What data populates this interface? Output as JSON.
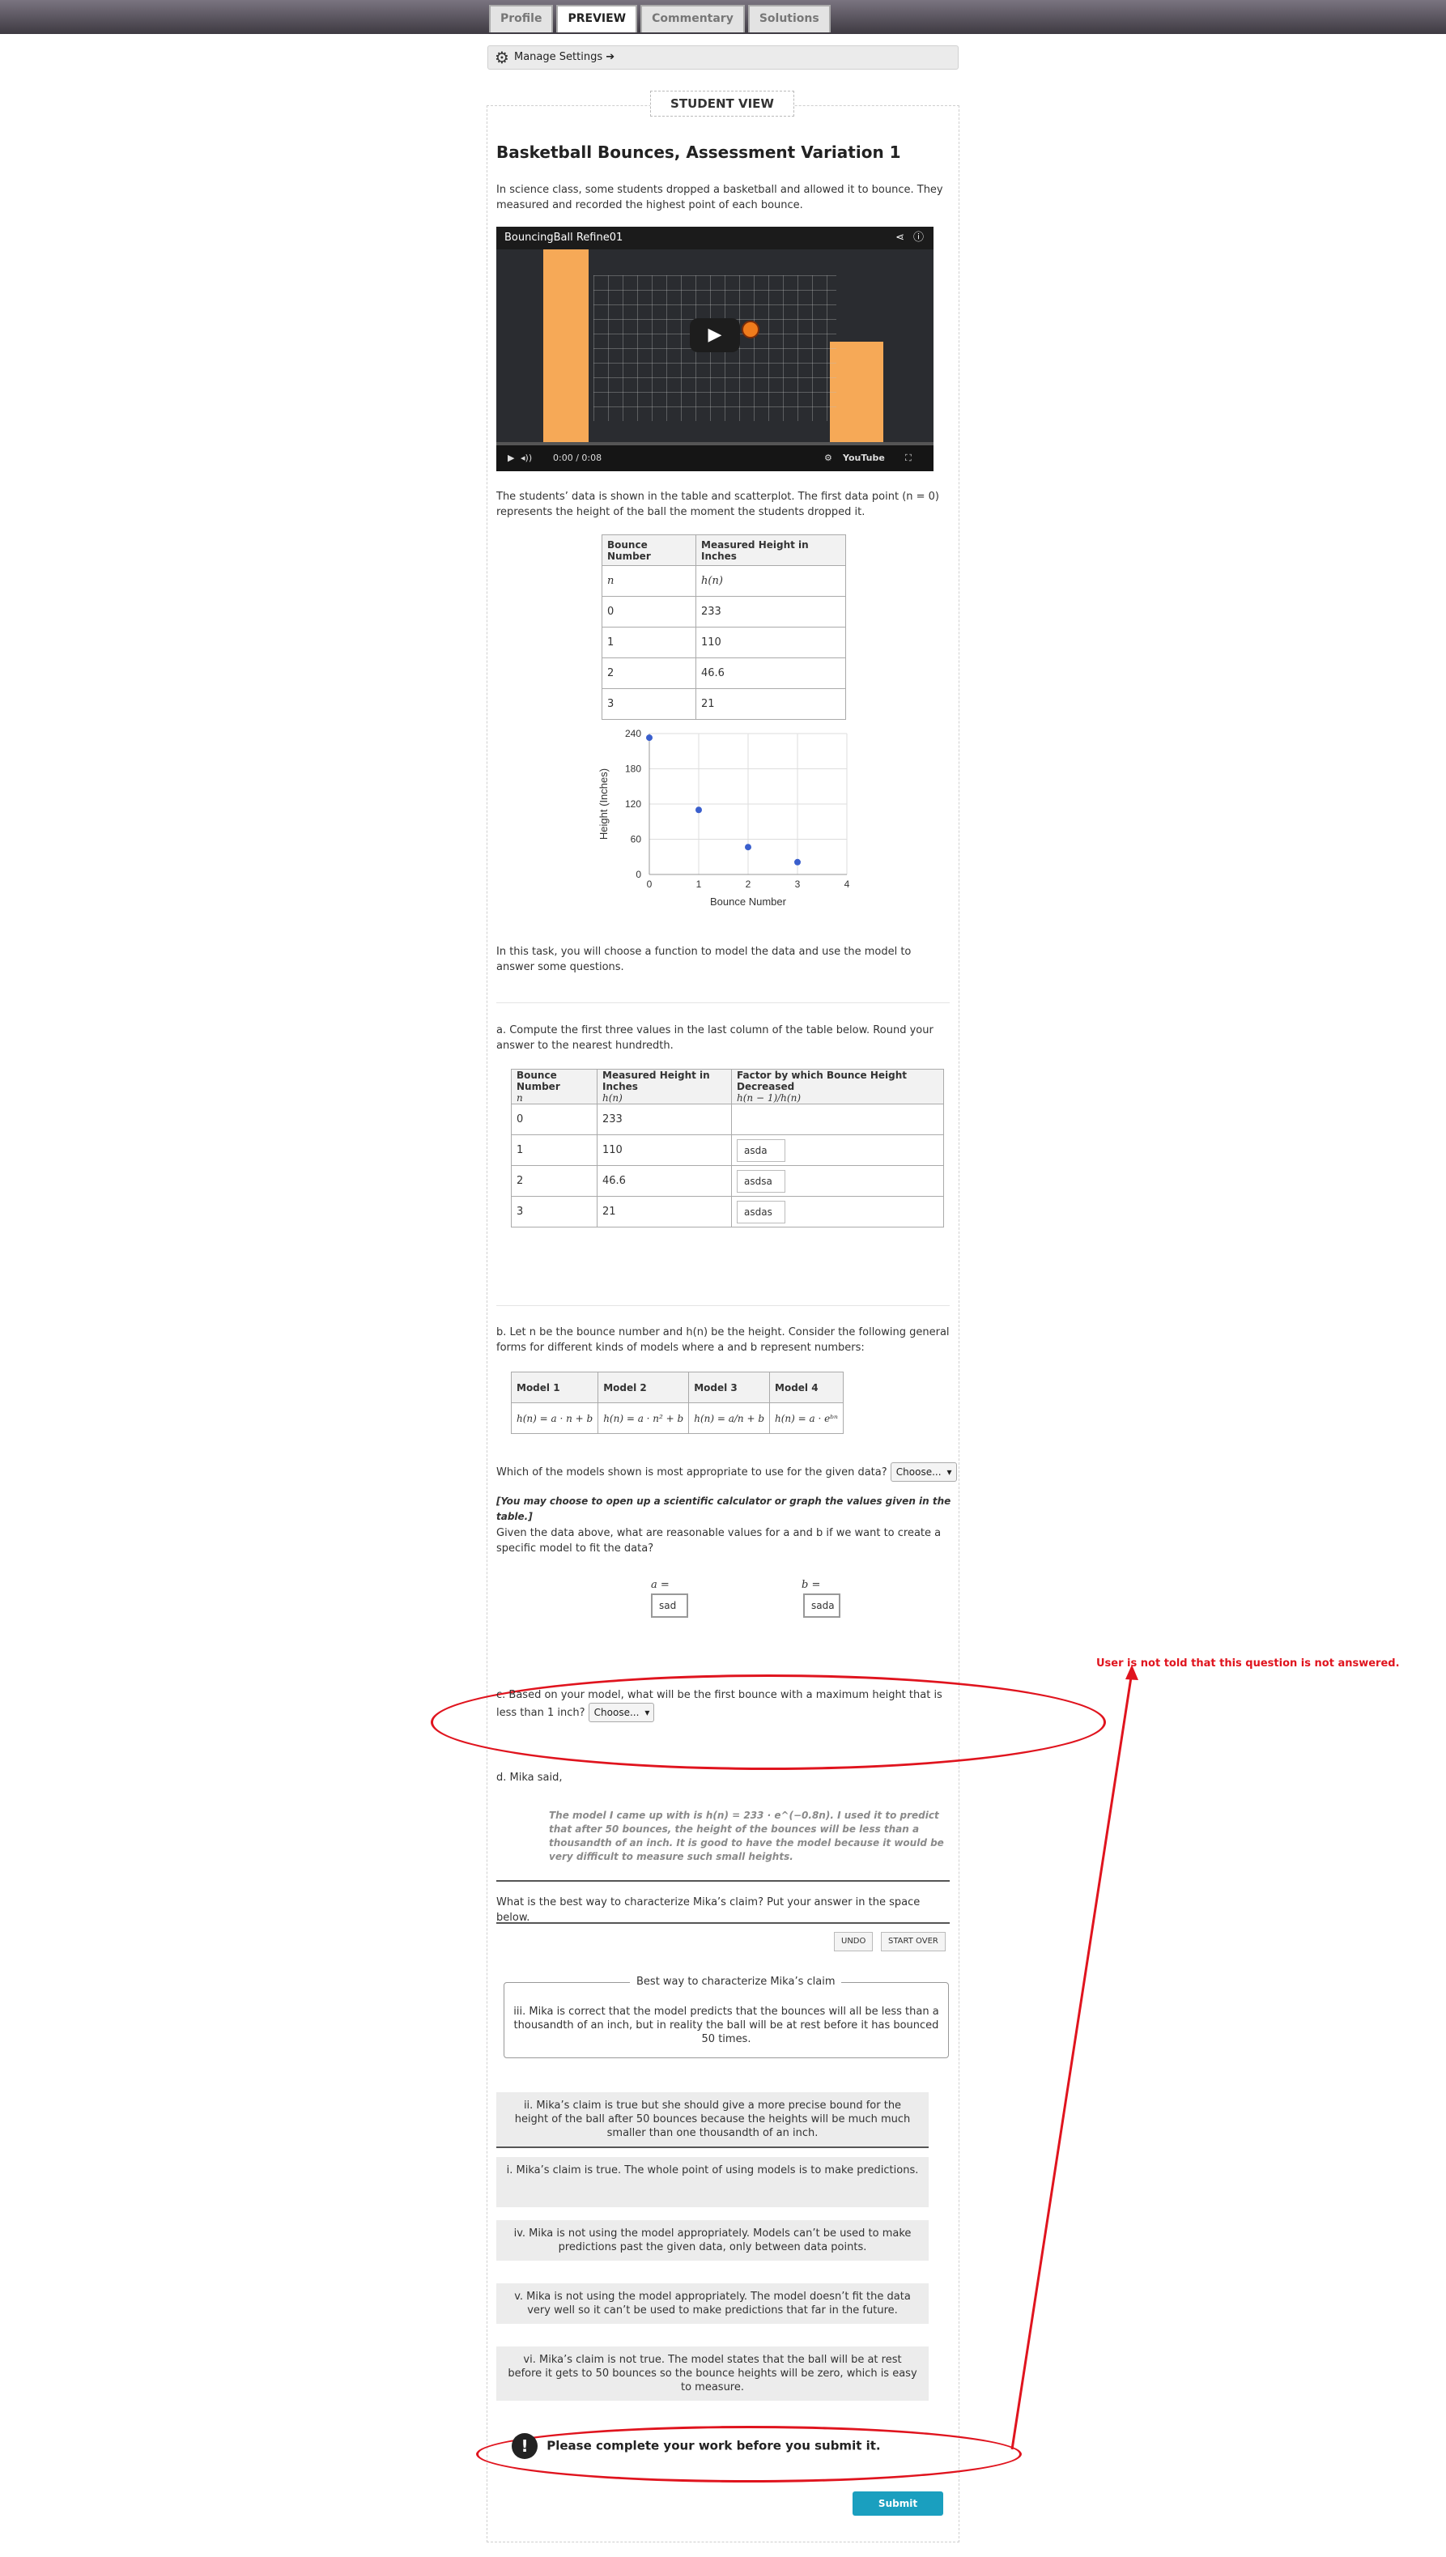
{
  "tabs": [
    "Profile",
    "PREVIEW",
    "Commentary",
    "Solutions"
  ],
  "manage_settings": "Manage Settings ➔",
  "student_view": "STUDENT VIEW",
  "title": "Basketball Bounces, Assessment Variation 1",
  "intro": "In science class, some students dropped a basketball and allowed it to bounce. They measured and recorded the highest point of each bounce.",
  "video": {
    "title": "BouncingBall Refine01",
    "time": "0:00 / 0:08",
    "logo": "YouTube"
  },
  "data_intro": "The students’ data is shown in the table and scatterplot. The first data point (n = 0) represents the height of the ball the moment the students dropped it.",
  "table1": {
    "headers": [
      "Bounce Number",
      "Measured Height in Inches"
    ],
    "vars": [
      "n",
      "h(n)"
    ],
    "rows": [
      [
        "0",
        "233"
      ],
      [
        "1",
        "110"
      ],
      [
        "2",
        "46.6"
      ],
      [
        "3",
        "21"
      ]
    ]
  },
  "chart_data": {
    "type": "scatter",
    "x": [
      0,
      1,
      2,
      3
    ],
    "y": [
      233,
      110,
      46.6,
      21
    ],
    "xlabel": "Bounce Number",
    "ylabel": "Height (Inches)",
    "xlim": [
      0,
      4
    ],
    "ylim": [
      0,
      240
    ],
    "xticks": [
      "0",
      "1",
      "2",
      "3",
      "4"
    ],
    "yticks": [
      "0",
      "60",
      "120",
      "180",
      "240"
    ],
    "grid": true,
    "color": "#3a5fcd"
  },
  "task_intro": "In this task, you will choose a function to model the data and use the model to answer some questions.",
  "part_a": {
    "prompt": "a. Compute the first three values in the last column of the table below. Round your answer to the nearest hundredth.",
    "headers": [
      "Bounce Number",
      "Measured Height in Inches",
      "Factor by which Bounce Height Decreased"
    ],
    "vars": [
      "n",
      "h(n)",
      "h(n − 1)/h(n)"
    ],
    "rows": [
      {
        "n": "0",
        "h": "233",
        "answer": ""
      },
      {
        "n": "1",
        "h": "110",
        "answer": "asda"
      },
      {
        "n": "2",
        "h": "46.6",
        "answer": "asdsa"
      },
      {
        "n": "3",
        "h": "21",
        "answer": "asdas"
      }
    ]
  },
  "part_b": {
    "prompt": "b. Let n be the bounce number and h(n) be the height. Consider the following general forms for different kinds of models where a and b represent numbers:",
    "models": [
      {
        "name": "Model 1",
        "formula": "h(n) = a · n + b"
      },
      {
        "name": "Model 2",
        "formula": "h(n) = a · n² + b"
      },
      {
        "name": "Model 3",
        "formula": "h(n) = a/n + b"
      },
      {
        "name": "Model 4",
        "formula": "h(n) = a · eᵇⁿ"
      }
    ],
    "question": "Which of the models shown is most appropriate to use for the given data?",
    "select": "Choose...",
    "note": "[You may choose to open up a scientific calculator or graph the values given in the table.]",
    "values_prompt": "Given the data above, what are reasonable values for a and b if we want to create a specific model to fit the data?",
    "a_label": "a =",
    "a_value": "sad",
    "b_label": "b =",
    "b_value": "sada"
  },
  "annotation": "User is not told that this question is not answered.",
  "part_c": {
    "prompt": "c. Based on your model, what will be the first bounce with a maximum height that is less than 1 inch?",
    "select": "Choose..."
  },
  "part_d": {
    "prompt": "d. Mika said,",
    "quote": "The model I came up with is h(n) = 233 · e^(−0.8n). I used it to predict that after 50 bounces, the height of the bounces will be less than a thousandth of an inch. It is good to have the model because it would be very difficult to measure such small heights.",
    "question": "What is the best way to characterize Mika’s claim? Put your answer in the space below.",
    "undo": "UNDO",
    "start_over": "START OVER",
    "drop_label": "Best way to characterize Mika’s claim",
    "dropped": "iii. Mika is correct that the model predicts that the bounces will all be less than a thousandth of an inch, but in reality the ball will be at rest before it has bounced 50 times.",
    "options": [
      "ii. Mika’s claim is true but she should give a more precise bound for the height of the ball after 50 bounces because the heights will be much much smaller than one thousandth of an inch.",
      "i. Mika’s claim is true. The whole point of using models is to make predictions.",
      "iv. Mika is not using the model appropriately. Models can’t be used to make predictions past the given data, only between data points.",
      "v. Mika is not using the model appropriately. The model doesn’t fit the data very well so it can’t be used to make predictions that far in the future.",
      "vi. Mika’s claim is not true. The model states that the ball will be at rest before it gets to 50 bounces so the bounce heights will be zero, which is easy to measure."
    ]
  },
  "warning": "Please complete your work before you submit it.",
  "submit": "Submit"
}
